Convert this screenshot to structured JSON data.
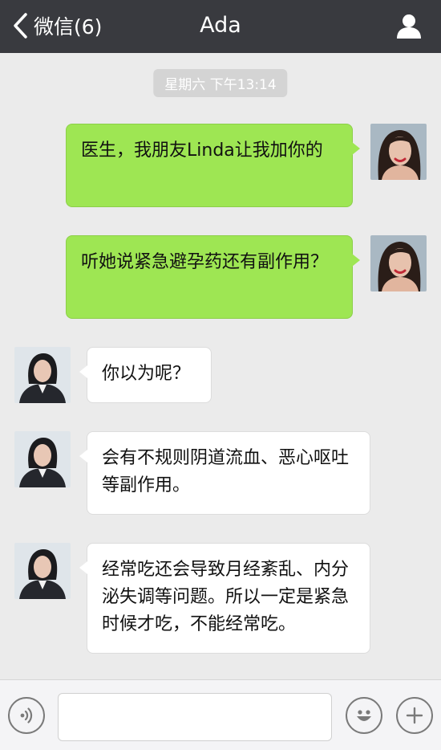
{
  "header": {
    "back_label": "微信(6)",
    "title": "Ada"
  },
  "timestamp": "星期六 下午13:14",
  "messages": [
    {
      "direction": "out",
      "text": "医生，我朋友Linda让我加你的"
    },
    {
      "direction": "out",
      "text": "听她说紧急避孕药还有副作用？"
    },
    {
      "direction": "in",
      "text": "你以为呢？"
    },
    {
      "direction": "in",
      "text": "会有不规则阴道流血、恶心呕吐等副作用。"
    },
    {
      "direction": "in",
      "text": "经常吃还会导致月经紊乱、内分泌失调等问题。所以一定是紧急时候才吃，不能经常吃。"
    }
  ],
  "input": {
    "value": "",
    "placeholder": ""
  },
  "icons": {
    "back": "chevron-left-icon",
    "profile": "person-icon",
    "voice": "voice-icon",
    "emoji": "emoji-icon",
    "add": "plus-icon"
  },
  "colors": {
    "header_bg": "#393a3f",
    "chat_bg": "#ebebeb",
    "outgoing_bubble": "#9ee653",
    "incoming_bubble": "#ffffff"
  }
}
